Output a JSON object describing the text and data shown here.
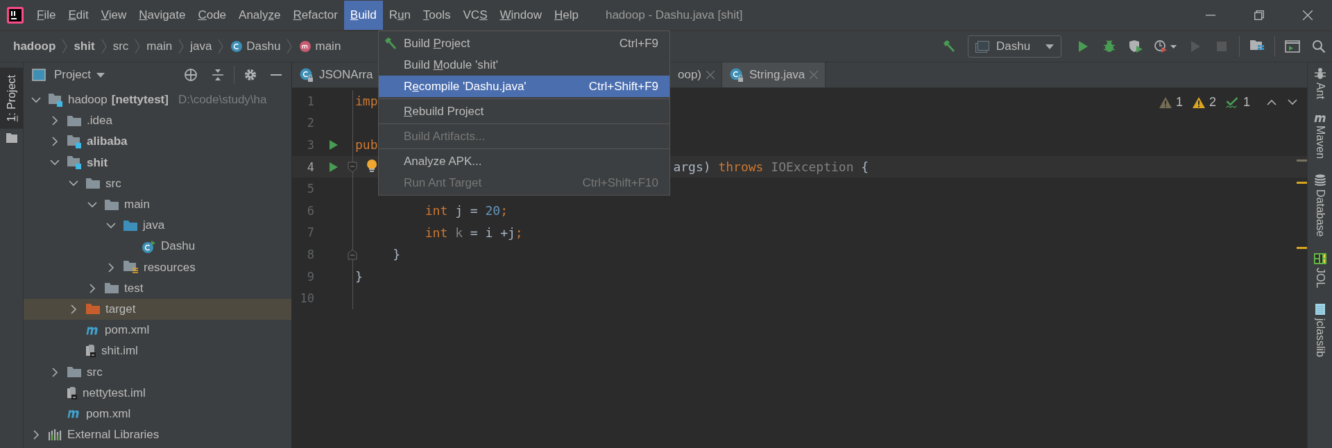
{
  "window": {
    "title": "hadoop - Dashu.java [shit]"
  },
  "menu_bar": [
    {
      "key": "F",
      "after": "ile",
      "selected": false
    },
    {
      "key": "E",
      "after": "dit",
      "selected": false
    },
    {
      "key": "V",
      "after": "iew",
      "selected": false
    },
    {
      "key": "N",
      "after": "avigate",
      "selected": false
    },
    {
      "key": "C",
      "after": "ode",
      "selected": false
    },
    {
      "before": "Analy",
      "key": "z",
      "after": "e",
      "selected": false
    },
    {
      "key": "R",
      "after": "efactor",
      "selected": false
    },
    {
      "key": "B",
      "after": "uild",
      "selected": true
    },
    {
      "before": "R",
      "key": "u",
      "after": "n",
      "selected": false
    },
    {
      "key": "T",
      "after": "ools",
      "selected": false
    },
    {
      "before": "VC",
      "key": "S",
      "selected": false
    },
    {
      "key": "W",
      "after": "indow",
      "selected": false
    },
    {
      "key": "H",
      "after": "elp",
      "selected": false
    }
  ],
  "build_menu": [
    {
      "kind": "item",
      "before": "Build ",
      "key": "P",
      "after": "roject",
      "shortcut": "Ctrl+F9",
      "selected": false,
      "disabled": false
    },
    {
      "kind": "item",
      "before": "Build ",
      "key": "M",
      "after": "odule 'shit'",
      "selected": false,
      "disabled": false
    },
    {
      "kind": "item",
      "before": "R",
      "key": "e",
      "after": "compile 'Dashu.java'",
      "shortcut": "Ctrl+Shift+F9",
      "selected": true,
      "disabled": false
    },
    {
      "kind": "separator"
    },
    {
      "kind": "item",
      "key": "R",
      "after": "ebuild Project",
      "selected": false,
      "disabled": false
    },
    {
      "kind": "separator"
    },
    {
      "kind": "item",
      "before": "Build Artifacts...",
      "selected": false,
      "disabled": true
    },
    {
      "kind": "separator"
    },
    {
      "kind": "item",
      "before": "Analyze APK...",
      "selected": false,
      "disabled": false
    },
    {
      "kind": "item",
      "before": "Run Ant Target",
      "shortcut": "Ctrl+Shift+F10",
      "selected": false,
      "disabled": true
    }
  ],
  "breadcrumbs": [
    {
      "label": "hadoop",
      "kind": "module"
    },
    {
      "label": "shit",
      "kind": "module"
    },
    {
      "label": "src",
      "kind": "folder"
    },
    {
      "label": "main",
      "kind": "folder"
    },
    {
      "label": "java",
      "kind": "folder"
    },
    {
      "label": "Dashu",
      "kind": "class"
    },
    {
      "label": "main",
      "kind": "method"
    }
  ],
  "run_configuration": "Dashu",
  "left_stripe": [
    {
      "key": "1",
      "after": ": Project",
      "selected": true
    }
  ],
  "project_panel": {
    "title": "Project",
    "tree": [
      {
        "name": "hadoop",
        "tag": "[nettytest]",
        "path": "D:\\code\\study\\ha",
        "kind": "module",
        "expanded": true,
        "selected": false,
        "children": [
          {
            "name": ".idea",
            "kind": "folder",
            "expanded": false,
            "selected": false
          },
          {
            "name": "alibaba",
            "kind": "module",
            "bold": true,
            "expanded": false,
            "selected": false
          },
          {
            "name": "shit",
            "kind": "module",
            "bold": true,
            "expanded": true,
            "selected": false,
            "children": [
              {
                "name": "src",
                "kind": "folder",
                "expanded": true,
                "selected": false,
                "children": [
                  {
                    "name": "main",
                    "kind": "folder",
                    "expanded": true,
                    "selected": false,
                    "children": [
                      {
                        "name": "java",
                        "kind": "source",
                        "expanded": true,
                        "selected": false,
                        "children": [
                          {
                            "name": "Dashu",
                            "kind": "class",
                            "selected": false
                          }
                        ]
                      },
                      {
                        "name": "resources",
                        "kind": "resources",
                        "expanded": false,
                        "selected": false
                      }
                    ]
                  },
                  {
                    "name": "test",
                    "kind": "folder",
                    "expanded": false,
                    "selected": false
                  }
                ]
              },
              {
                "name": "target",
                "kind": "excluded",
                "expanded": false,
                "selected": true
              },
              {
                "name": "pom.xml",
                "kind": "maven",
                "selected": false
              },
              {
                "name": "shit.iml",
                "kind": "iml",
                "selected": false
              }
            ]
          },
          {
            "name": "src",
            "kind": "folder",
            "expanded": false,
            "selected": false
          },
          {
            "name": "nettytest.iml",
            "kind": "iml",
            "selected": false
          },
          {
            "name": "pom.xml",
            "kind": "maven",
            "selected": false
          }
        ]
      },
      {
        "name": "External Libraries",
        "kind": "libraries",
        "expanded": false,
        "selected": false
      }
    ]
  },
  "editor_tabs": [
    {
      "label": "JSONArra",
      "selected": false
    },
    {
      "label": "oop)",
      "selected": false,
      "closable": true
    },
    {
      "label": "String.java",
      "selected": true,
      "closable": true
    }
  ],
  "inspections": [
    {
      "kind": "weak_warning",
      "count": "1"
    },
    {
      "kind": "warning",
      "count": "2"
    },
    {
      "kind": "typo",
      "count": "1"
    }
  ],
  "code_lines": [
    {
      "number": "1",
      "tokens": [
        {
          "text": "imp",
          "kind": "keyword"
        }
      ]
    },
    {
      "number": "2"
    },
    {
      "number": "3",
      "run": true,
      "tokens": [
        {
          "text": "pub",
          "kind": "keyword"
        }
      ]
    },
    {
      "number": "4",
      "run": true,
      "current": true,
      "fold_start": true,
      "bulb": true,
      "tokens": [
        {
          "text": "args) ",
          "kind": "plain"
        },
        {
          "text": "throws",
          "kind": "keyword"
        },
        {
          "text": " IOException",
          "kind": "unused"
        },
        {
          "text": " {",
          "kind": "plain"
        }
      ]
    },
    {
      "number": "5"
    },
    {
      "number": "6",
      "tokens": [
        {
          "text": "int",
          "kind": "keyword"
        },
        {
          "text": " j = ",
          "kind": "plain"
        },
        {
          "text": "20",
          "kind": "number"
        },
        {
          "text": ";",
          "kind": "keyword"
        }
      ]
    },
    {
      "number": "7",
      "tokens": [
        {
          "text": "int",
          "kind": "keyword"
        },
        {
          "text": " k",
          "kind": "unused"
        },
        {
          "text": " = i +j",
          "kind": "plain"
        },
        {
          "text": ";",
          "kind": "keyword"
        }
      ]
    },
    {
      "number": "8",
      "fold_end": true,
      "tokens": [
        {
          "text": "}",
          "kind": "plain"
        }
      ]
    },
    {
      "number": "9",
      "tokens": [
        {
          "text": "}",
          "kind": "plain"
        }
      ]
    },
    {
      "number": "10"
    }
  ],
  "right_stripe": [
    {
      "label": "Ant",
      "kind": "ant",
      "selected": false
    },
    {
      "label": "Maven",
      "kind": "maven",
      "selected": false
    },
    {
      "label": "Database",
      "kind": "database",
      "selected": false
    },
    {
      "label": "JOL",
      "kind": "jol",
      "selected": false
    },
    {
      "label": "jclasslib",
      "kind": "jclasslib",
      "selected": false
    }
  ]
}
